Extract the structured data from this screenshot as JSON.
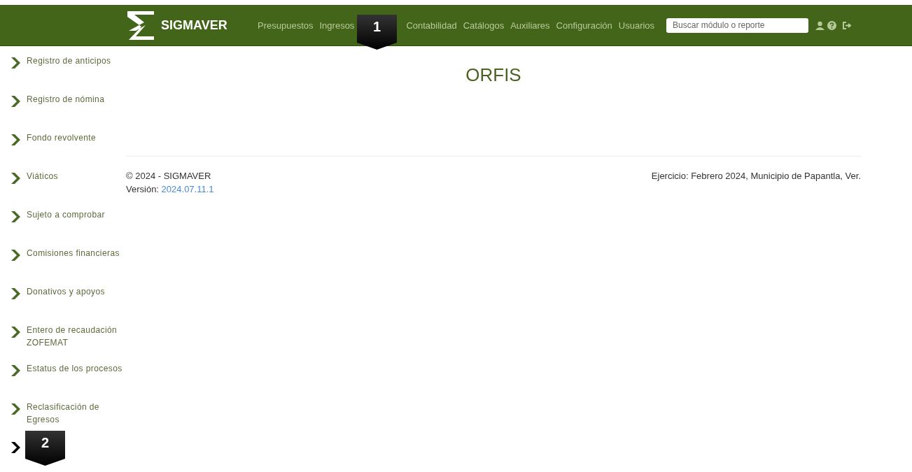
{
  "navbar": {
    "brand": "SIGMAVER",
    "menu": [
      {
        "label": "Presupuestos"
      },
      {
        "label": "Ingresos"
      },
      {
        "label": "Contabilidad"
      },
      {
        "label": "Catálogos"
      },
      {
        "label": "Auxiliares"
      },
      {
        "label": "Configuración"
      },
      {
        "label": "Usuarios"
      }
    ],
    "search": {
      "placeholder": "Buscar módulo o reporte"
    }
  },
  "sidebar": {
    "items": [
      {
        "label": "Registro de anticipos"
      },
      {
        "label": "Registro de nómina"
      },
      {
        "label": "Fondo revolvente"
      },
      {
        "label": "Viáticos"
      },
      {
        "label": "Sujeto a comprobar"
      },
      {
        "label": "Comisiones financieras"
      },
      {
        "label": "Donativos y apoyos"
      },
      {
        "label": "Entero de recaudación ZOFEMAT"
      },
      {
        "label": "Estatus de los procesos"
      },
      {
        "label": "Reclasificación de Egresos"
      },
      {
        "kind": "icon_only"
      }
    ]
  },
  "main": {
    "subtitle": "ORFIS"
  },
  "footer": {
    "copyright": "© 2024 - SIGMAVER",
    "version_label": "Versión:",
    "version": "2024.07.11.1",
    "period": "Ejercicio: Febrero 2024, Municipio de Papantla, Ver."
  },
  "callouts": [
    {
      "number": "1"
    },
    {
      "number": "2"
    }
  ]
}
